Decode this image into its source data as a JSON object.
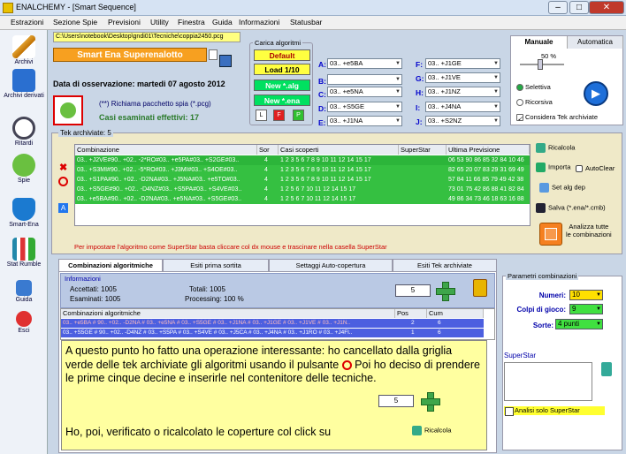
{
  "window": {
    "title": "ENALCHEMY - [Smart Sequence]"
  },
  "menu": [
    "Estrazioni",
    "Sezione Spie",
    "Previsioni",
    "Utility",
    "Finestra",
    "Guida",
    "Informazioni",
    "Statusbar"
  ],
  "sidebar": [
    "Archivi",
    "Archivi derivati",
    "Ritardi",
    "Spie",
    "Smart-Ena",
    "Stat Rumble",
    "Guida",
    "Esci"
  ],
  "path": "C:\\Users\\notebook\\Desktop\\gndi01\\Tecniche\\coppia2450.pcg",
  "game": "Smart Ena Superenalotto",
  "observation": "Data di osservazione:  martedi 07 agosto 2012",
  "richiama": "(**) Richiama pacchetto spia (*.pcg)",
  "casi": "Casi esaminati effettivi: 17",
  "carica": {
    "title": "Carica algoritmi",
    "default": "Default",
    "load": "Load 1/10",
    "new_alg": "New *.alg",
    "new_ena": "New *.ena",
    "l": "L",
    "f": "F",
    "p": "P",
    "colors": {
      "default": "#ffff40",
      "load": "#ffff40",
      "new": "#00e060",
      "f": "#e02020",
      "p": "#30c030"
    }
  },
  "algs": {
    "left": [
      {
        "k": "A:",
        "v": "03.. +e5BA"
      },
      {
        "k": "B:",
        "v": ""
      },
      {
        "k": "C:",
        "v": "03.. +e5NA"
      },
      {
        "k": "D:",
        "v": "03.. +S5GE"
      },
      {
        "k": "E:",
        "v": "03.. +J1NA"
      }
    ],
    "right": [
      {
        "k": "F:",
        "v": "03.. +J1GE"
      },
      {
        "k": "G:",
        "v": "03.. +J1VE"
      },
      {
        "k": "H:",
        "v": "03.. +J1NZ"
      },
      {
        "k": "I:",
        "v": "03.. +J4NA"
      },
      {
        "k": "J:",
        "v": "03.. +S2NZ"
      }
    ]
  },
  "tabbox": {
    "tab1": "Manuale",
    "tab2": "Automatica",
    "pct": "50 %",
    "opt1": "Selettiva",
    "opt2": "Ricorsiva",
    "check": "Considera Tek archiviate"
  },
  "tek": {
    "header": "Tek archiviate: 5",
    "cols": [
      "Combinazione",
      "Sor",
      "Casi scoperti",
      "SuperStar",
      "Ultima Previsione"
    ],
    "rows": [
      [
        "03.. +J2VE#90.. +02.. -2*RO#03.. +e5PA#03.. +S2GE#03..",
        "4",
        "1 2 3 5 6 7 8 9 10 11 12 14 15 17",
        "",
        "06 53 90 86 85 32 84 10 46"
      ],
      [
        "03.. +S3MI#90.. +02.. -5*RO#03.. +J3MI#03.. +S4OE#03..",
        "4",
        "1 2 3 5 6 7 8 9 10 11 12 14 15 17",
        "",
        "82 65 20 07 83 29 31 69 49"
      ],
      [
        "03.. +S1PA#90.. +02.. -D2NA#03.. +J5NA#03.. +e5TO#03..",
        "4",
        "1 2 3 5 6 7 8 9 10 11 12 14 15 17",
        "",
        "57 84 11 66 85 79 49 42 38"
      ],
      [
        "03.. +S5GE#90.. +02.. -D4NZ#03.. +S5PA#03.. +S4VE#03..",
        "4",
        "1 2 5 6 7 10 11 12 14 15 17",
        "",
        "73 01 75 42 86 88 41 82 84"
      ],
      [
        "03.. +e5BA#90.. +02.. -D2NA#03.. +e5NA#03.. +S5GE#03..",
        "4",
        "1 2 5 6 7 10 11 12 14 15 17",
        "",
        "49 86 34 73 46 18 63 16 88"
      ]
    ],
    "right": {
      "ricalcola": "Ricalcola",
      "importa": "Importa",
      "autoclear": "AutoClear",
      "setalg": "Set alg dep",
      "salva": "Salva (*.ena/*.cmb)",
      "analizza1": "Analizza tutte",
      "analizza2": "le combinazioni"
    },
    "tip": "Per impostare l'algoritmo come SuperStar basta cliccare col dx mouse e trascinare nella casella SuperStar"
  },
  "tabs2": [
    "Combinazioni algoritmiche",
    "Esiti prima sortita",
    "Settaggi Auto-copertura",
    "Esiti Tek archiviate"
  ],
  "info": {
    "title": "Informazioni",
    "accettati": "Accettati:  1005",
    "esaminati": "Esaminati:  1005",
    "totali": "Totali:  1005",
    "processing": "Processing:  100 %",
    "num": "5"
  },
  "comb": {
    "cols": [
      "Combinazioni algoritmiche",
      "Pos",
      "Cum"
    ],
    "rows": [
      [
        "03.. +e5BA # 90.. +02.. -D2NA # 03.. +e5NA # 03.. +S5GE # 03.. +J1NA # 03.. +J1GE # 03.. +J1VE # 03.. +J1N..",
        "2",
        "6"
      ],
      [
        "03.. +S5GE # 90.. +02.. -D4NZ # 03.. +S5PA # 03.. +S4VE # 03.. +J5CA # 03.. +J4NA # 03.. +J1RO # 03.. +J4Fl..",
        "1",
        "6"
      ]
    ]
  },
  "callout": {
    "p1": "A questo punto ho fatto una operazione interessante: ho cancellato dalla griglia verde delle tek archiviate gli algoritmi usando il pulsante",
    "p1b": "Poi ho deciso di prendere le prime cinque decine e inserirle nel contenitore delle tecniche.",
    "num": "5",
    "p2": "Ho, poi, verificato o ricalcolato le coperture col click su",
    "ricalcola": "Ricalcola"
  },
  "params": {
    "title": "Parametri combinazioni",
    "numeri": "Numeri:",
    "numeri_v": "10",
    "colpi": "Colpi di gioco:",
    "colpi_v": "9",
    "sorte": "Sorte:",
    "sorte_v": "4 punti",
    "superstar": "SuperStar",
    "analisi": "Analisi solo SuperStar"
  }
}
